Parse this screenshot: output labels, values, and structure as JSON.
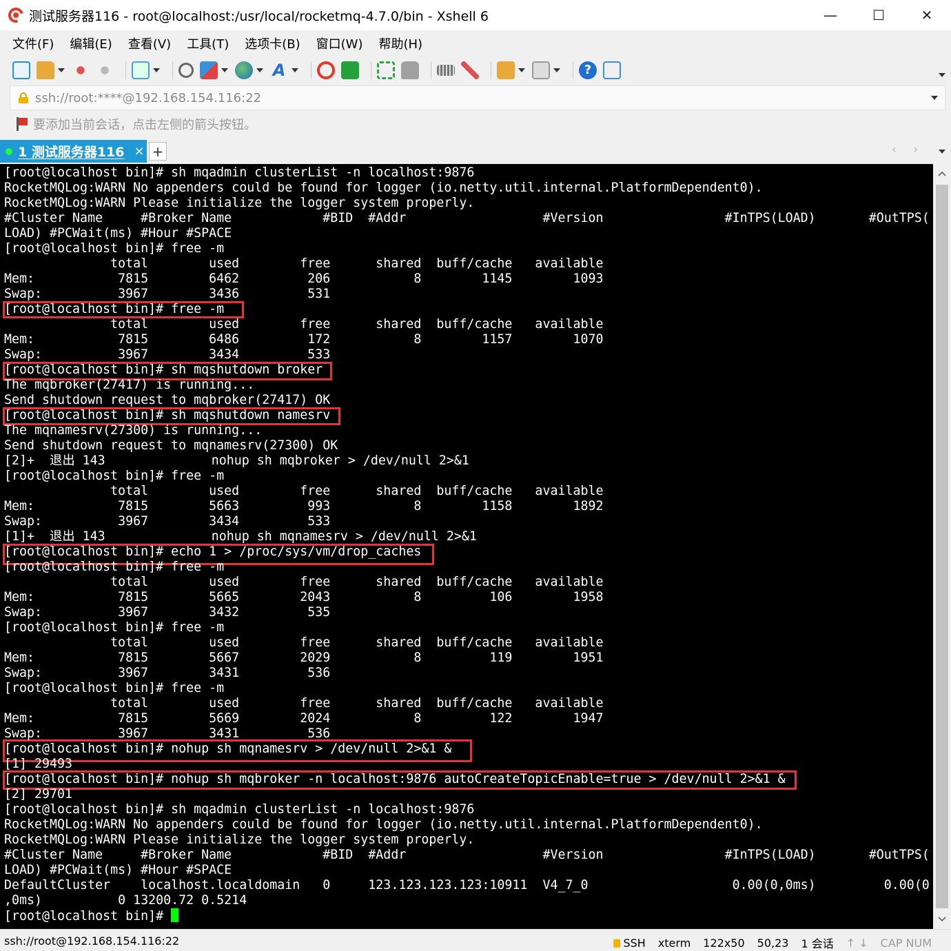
{
  "window": {
    "title": "测试服务器116 - root@localhost:/usr/local/rocketmq-4.7.0/bin - Xshell 6",
    "minimize_glyph": "—",
    "maximize_glyph": "☐",
    "close_glyph": "✕"
  },
  "menu": [
    "文件(F)",
    "编辑(E)",
    "查看(V)",
    "工具(T)",
    "选项卡(B)",
    "窗口(W)",
    "帮助(H)"
  ],
  "address": {
    "value": "ssh://root:****@192.168.154.116:22"
  },
  "hint": "要添加当前会话，点击左侧的箭头按钮。",
  "tab": {
    "label": "1 测试服务器116",
    "close": "×",
    "add": "+",
    "nav": "‹ ›"
  },
  "terminal": {
    "lines": [
      "[root@localhost bin]# sh mqadmin clusterList -n localhost:9876",
      "RocketMQLog:WARN No appenders could be found for logger (io.netty.util.internal.PlatformDependent0).",
      "RocketMQLog:WARN Please initialize the logger system properly.",
      "#Cluster Name     #Broker Name            #BID  #Addr                  #Version                #InTPS(LOAD)       #OutTPS(",
      "LOAD) #PCWait(ms) #Hour #SPACE",
      "[root@localhost bin]# free -m",
      "              total        used        free      shared  buff/cache   available",
      "Mem:           7815        6462         206           8        1145        1093",
      "Swap:          3967        3436         531",
      "[root@localhost bin]# free -m",
      "              total        used        free      shared  buff/cache   available",
      "Mem:           7815        6486         172           8        1157        1070",
      "Swap:          3967        3434         533",
      "[root@localhost bin]# sh mqshutdown broker",
      "The mqbroker(27417) is running...",
      "Send shutdown request to mqbroker(27417) OK",
      "[root@localhost bin]# sh mqshutdown namesrv",
      "The mqnamesrv(27300) is running...",
      "Send shutdown request to mqnamesrv(27300) OK",
      "[2]+  退出 143              nohup sh mqbroker > /dev/null 2>&1",
      "[root@localhost bin]# free -m",
      "              total        used        free      shared  buff/cache   available",
      "Mem:           7815        5663         993           8        1158        1892",
      "Swap:          3967        3434         533",
      "[1]+  退出 143              nohup sh mqnamesrv > /dev/null 2>&1",
      "[root@localhost bin]# echo 1 > /proc/sys/vm/drop_caches",
      "[root@localhost bin]# free -m",
      "              total        used        free      shared  buff/cache   available",
      "Mem:           7815        5665        2043           8         106        1958",
      "Swap:          3967        3432         535",
      "[root@localhost bin]# free -m",
      "              total        used        free      shared  buff/cache   available",
      "Mem:           7815        5667        2029           8         119        1951",
      "Swap:          3967        3431         536",
      "[root@localhost bin]# free -m",
      "              total        used        free      shared  buff/cache   available",
      "Mem:           7815        5669        2024           8         122        1947",
      "Swap:          3967        3431         536",
      "[root@localhost bin]# nohup sh mqnamesrv > /dev/null 2>&1 &",
      "[1] 29493",
      "[root@localhost bin]# nohup sh mqbroker -n localhost:9876 autoCreateTopicEnable=true > /dev/null 2>&1 &",
      "[2] 29701",
      "[root@localhost bin]# sh mqadmin clusterList -n localhost:9876",
      "RocketMQLog:WARN No appenders could be found for logger (io.netty.util.internal.PlatformDependent0).",
      "RocketMQLog:WARN Please initialize the logger system properly.",
      "#Cluster Name     #Broker Name            #BID  #Addr                  #Version                #InTPS(LOAD)       #OutTPS(",
      "LOAD) #PCWait(ms) #Hour #SPACE",
      "DefaultCluster    localhost.localdomain   0     123.123.123.123:10911  V4_7_0                   0.00(0,0ms)         0.00(0",
      ",0ms)          0 13200.72 0.5214",
      "[root@localhost bin]# "
    ]
  },
  "status": {
    "connection": "ssh://root@192.168.154.116:22",
    "protocol": "SSH",
    "terminal_type": "xterm",
    "size": "122x50",
    "cursor_pos": "50,23",
    "sessions": "1 会话",
    "arrows": "↑ ↓",
    "caps": "CAP NUM"
  },
  "colors": {
    "tab_active": "#1f9ad6",
    "highlight_box": "#e8323a",
    "cursor": "#00ff00",
    "terminal_bg": "#000000"
  },
  "toolbar_icons": [
    "new-session-icon",
    "open-folder-icon",
    "disconnect-icon",
    "reconnect-icon",
    "properties-icon",
    "find-icon",
    "transfer-icon",
    "globe-icon",
    "font-icon",
    "xftp-icon",
    "xshell-icon",
    "fullscreen-icon",
    "lock-icon",
    "keyboard-icon",
    "highlight-icon",
    "compose-icon",
    "layout-icon",
    "help-icon",
    "chat-icon"
  ]
}
